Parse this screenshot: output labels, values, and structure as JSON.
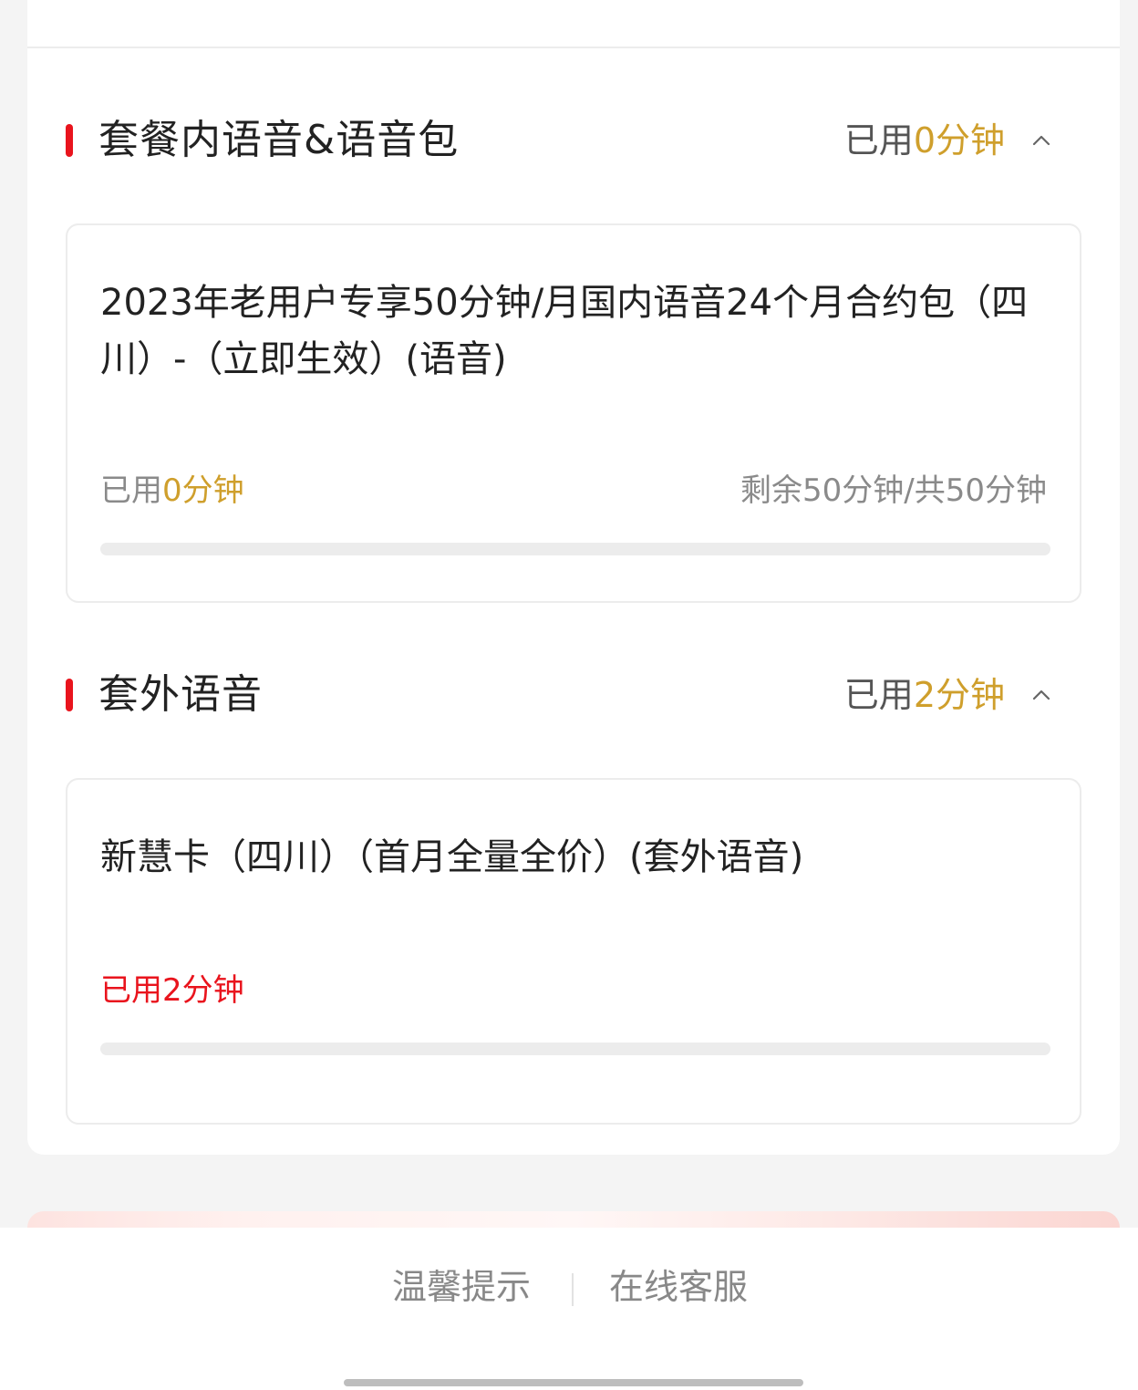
{
  "sections": [
    {
      "title": "套餐内语音&语音包",
      "summary_prefix": "已用",
      "summary_value": "0分钟",
      "expanded": true,
      "items": [
        {
          "name": "2023年老用户专享50分钟/月国内语音24个月合约包（四川）-（立即生效）(语音)",
          "used_prefix": "已用",
          "used_value": "0分钟",
          "remaining": "剩余50分钟/共50分钟",
          "progress_fraction": 0
        }
      ]
    },
    {
      "title": "套外语音",
      "summary_prefix": "已用",
      "summary_value": "2分钟",
      "expanded": true,
      "items": [
        {
          "name": "新慧卡（四川）（首月全量全价）(套外语音)",
          "used_text": "已用2分钟",
          "progress_fraction": 0
        }
      ]
    }
  ],
  "footer": {
    "tips": "温馨提示",
    "service": "在线客服"
  },
  "colors": {
    "accent_red": "#e9141d",
    "gold": "#cf9f2c"
  },
  "icons": {
    "section_toggle": "chevron-up-icon"
  }
}
